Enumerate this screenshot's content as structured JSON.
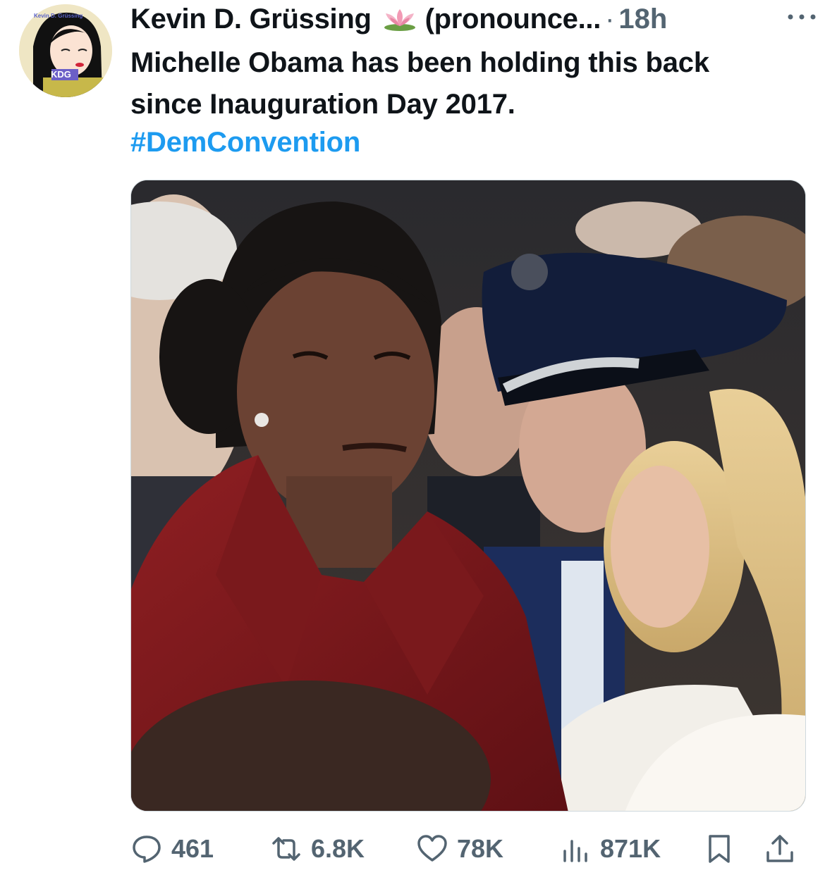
{
  "tweet": {
    "author_name": "Kevin D. Grüssing",
    "author_handle": "(pronounce...",
    "separator": "·",
    "timestamp": "18h",
    "text_line1": "Michelle Obama has been holding this back",
    "text_line2": "since Inauguration Day 2017.",
    "hashtag": "#DemConvention",
    "avatar_label": "KDG",
    "avatar_caption": "Kevin D. Grüssing"
  },
  "metrics": {
    "replies": "461",
    "reposts": "6.8K",
    "likes": "78K",
    "views": "871K"
  },
  "icons": {
    "reply": "reply-icon",
    "repost": "repost-icon",
    "like": "heart-icon",
    "views": "views-icon",
    "bookmark": "bookmark-icon",
    "share": "share-icon",
    "more": "more-icon",
    "emoji": "lotus-icon"
  },
  "colors": {
    "text": "#0f1419",
    "muted": "#536471",
    "link": "#1d9bf0"
  }
}
